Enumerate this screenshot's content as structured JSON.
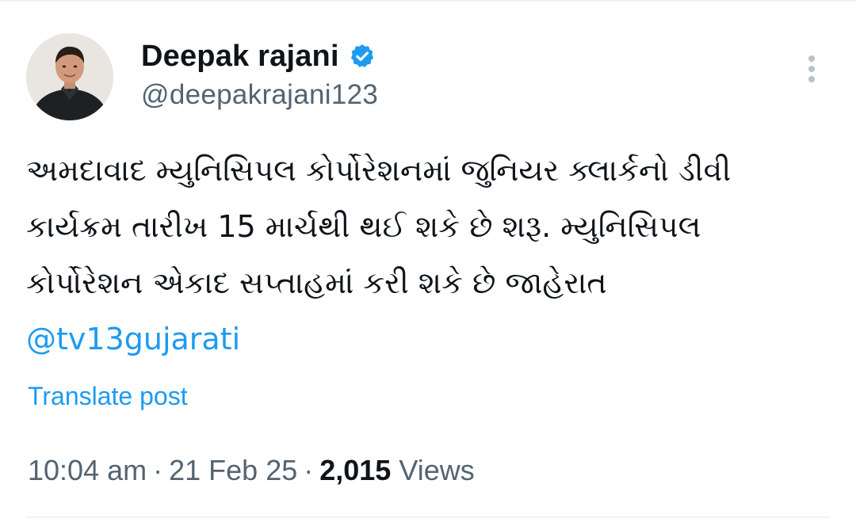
{
  "author": {
    "display_name": "Deepak rajani",
    "handle": "@deepakrajani123",
    "verified": true,
    "avatar_icon": "user-avatar-photo"
  },
  "tweet": {
    "lines": [
      "અમદાવાદ મ્યુનિસિપલ કોર્પોરેશનમાં જુનિયર ક્લાર્કનો ડીવી",
      "કાર્યક્રમ તારીખ 15 માર્ચથી થઈ શકે છે શરૂ. મ્યુનિસિપલ",
      "કોર્પોરેશન એકાદ સપ્તાહમાં કરી શકે છે જાહેરાત"
    ],
    "mention": "@tv13gujarati"
  },
  "actions": {
    "translate_label": "Translate post",
    "more_icon": "more-vertical-icon"
  },
  "meta": {
    "time": "10:04 am",
    "separator": "·",
    "date": "21 Feb 25",
    "views_count": "2,015",
    "views_label": "Views"
  },
  "colors": {
    "accent": "#1d9bf0",
    "text": "#0f1419",
    "muted": "#536471",
    "divider": "#eff3f4"
  }
}
